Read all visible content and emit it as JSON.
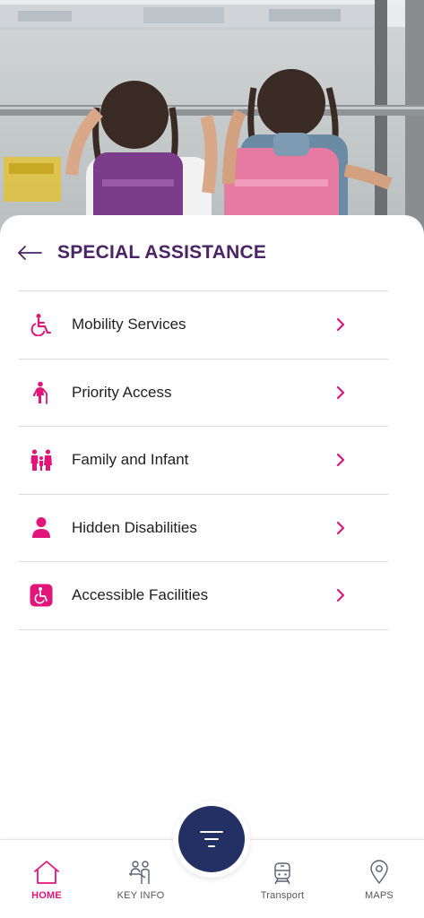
{
  "header": {
    "title": "SPECIAL ASSISTANCE"
  },
  "menu": {
    "items": [
      {
        "label": "Mobility Services",
        "icon": "wheelchair-icon"
      },
      {
        "label": "Priority Access",
        "icon": "elderly-person-icon"
      },
      {
        "label": "Family and Infant",
        "icon": "family-icon"
      },
      {
        "label": "Hidden Disabilities",
        "icon": "person-icon"
      },
      {
        "label": "Accessible Facilities",
        "icon": "accessible-facility-icon"
      }
    ]
  },
  "bottom_nav": {
    "home": "HOME",
    "key_info": "KEY INFO",
    "transport": "Transport",
    "maps": "MAPS"
  },
  "colors": {
    "accent": "#e2167a",
    "title": "#4b2466",
    "fab": "#223063"
  }
}
